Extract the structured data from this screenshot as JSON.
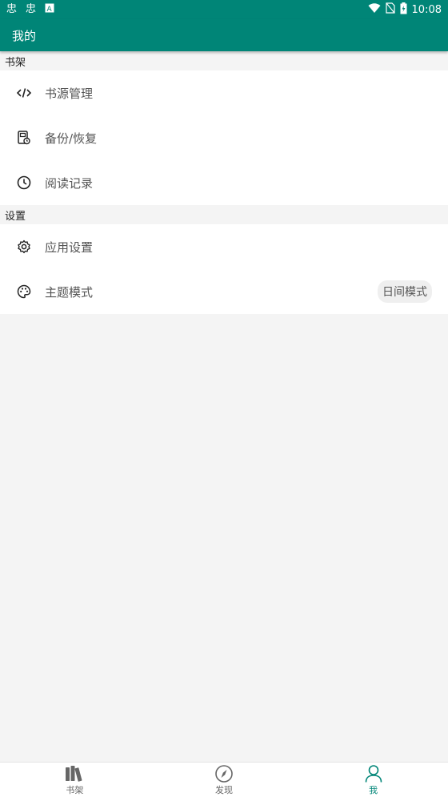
{
  "status_bar": {
    "time": "10:08",
    "left_icons": [
      "bug-icon",
      "bug-icon",
      "accessibility-icon"
    ],
    "right_icons": [
      "wifi-icon",
      "no-sim-icon",
      "battery-charging-icon"
    ]
  },
  "toolbar": {
    "title": "我的"
  },
  "sections": [
    {
      "header": "书架",
      "items": [
        {
          "icon": "code-icon",
          "label": "书源管理"
        },
        {
          "icon": "backup-icon",
          "label": "备份/恢复"
        },
        {
          "icon": "clock-icon",
          "label": "阅读记录"
        }
      ]
    },
    {
      "header": "设置",
      "items": [
        {
          "icon": "gear-icon",
          "label": "应用设置"
        },
        {
          "icon": "palette-icon",
          "label": "主题模式",
          "value": "日间模式"
        }
      ]
    }
  ],
  "bottom_nav": [
    {
      "icon": "books-icon",
      "label": "书架",
      "active": false
    },
    {
      "icon": "compass-icon",
      "label": "发现",
      "active": false
    },
    {
      "icon": "person-icon",
      "label": "我",
      "active": true
    }
  ],
  "colors": {
    "primary": "#008577",
    "background": "#f4f4f4",
    "text": "#555555"
  }
}
